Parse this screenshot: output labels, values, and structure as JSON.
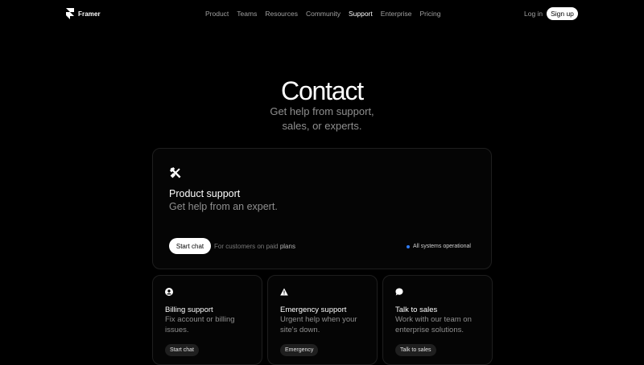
{
  "header": {
    "brand": "Framer",
    "nav": [
      "Product",
      "Teams",
      "Resources",
      "Community",
      "Support",
      "Enterprise",
      "Pricing"
    ],
    "active": "Support",
    "login": "Log in",
    "signup": "Sign up"
  },
  "hero": {
    "title": "Contact",
    "subtitle_line1": "Get help from support,",
    "subtitle_line2": "sales, or experts."
  },
  "product_support": {
    "title": "Product support",
    "desc": "Get help from an expert.",
    "button": "Start chat",
    "note_prefix": "For customers on paid",
    "note_link": "plans",
    "status": "All systems operational",
    "status_color": "#2f7cf6"
  },
  "cards": [
    {
      "icon": "user-icon",
      "title": "Billing support",
      "desc": "Fix account or billing issues.",
      "button": "Start chat"
    },
    {
      "icon": "warning-icon",
      "title": "Emergency support",
      "desc": "Urgent help when your site's down.",
      "button": "Emergency"
    },
    {
      "icon": "chat-bubble-icon",
      "title": "Talk to sales",
      "desc": "Work with our team on enterprise solutions.",
      "button": "Talk to sales"
    }
  ]
}
